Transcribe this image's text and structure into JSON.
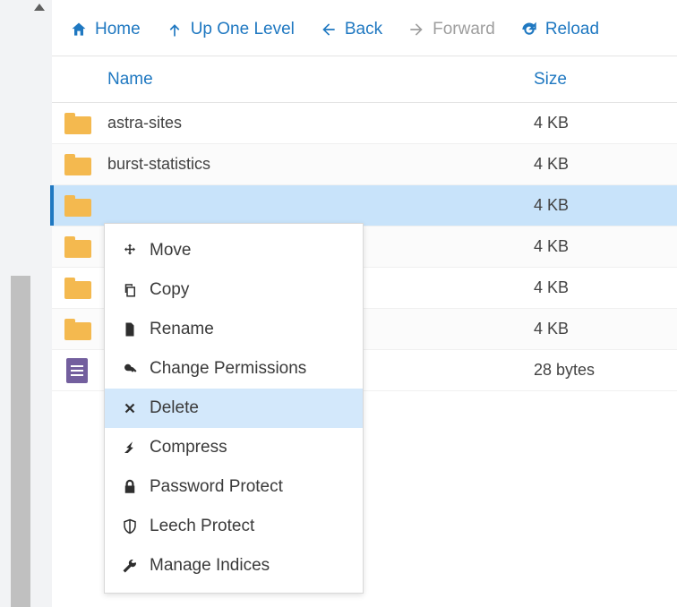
{
  "toolbar": {
    "home": {
      "label": "Home"
    },
    "up": {
      "label": "Up One Level"
    },
    "back": {
      "label": "Back"
    },
    "forward": {
      "label": "Forward"
    },
    "reload": {
      "label": "Reload"
    }
  },
  "columns": {
    "name": "Name",
    "size": "Size"
  },
  "rows": [
    {
      "type": "folder",
      "name": "astra-sites",
      "size": "4 KB",
      "selected": false
    },
    {
      "type": "folder",
      "name": "burst-statistics",
      "size": "4 KB",
      "selected": false
    },
    {
      "type": "folder",
      "name": "",
      "size": "4 KB",
      "selected": true
    },
    {
      "type": "folder",
      "name": "",
      "size": "4 KB",
      "selected": false
    },
    {
      "type": "folder",
      "name": "",
      "size": "4 KB",
      "selected": false
    },
    {
      "type": "folder",
      "name": "",
      "size": "4 KB",
      "selected": false
    },
    {
      "type": "file",
      "name": "",
      "size": "28 bytes",
      "selected": false
    }
  ],
  "contextMenu": {
    "items": [
      {
        "icon": "move",
        "label": "Move",
        "hover": false
      },
      {
        "icon": "copy",
        "label": "Copy",
        "hover": false
      },
      {
        "icon": "rename",
        "label": "Rename",
        "hover": false
      },
      {
        "icon": "key",
        "label": "Change Permissions",
        "hover": false
      },
      {
        "icon": "delete",
        "label": "Delete",
        "hover": true
      },
      {
        "icon": "compress",
        "label": "Compress",
        "hover": false
      },
      {
        "icon": "lock",
        "label": "Password Protect",
        "hover": false
      },
      {
        "icon": "shield",
        "label": "Leech Protect",
        "hover": false
      },
      {
        "icon": "wrench",
        "label": "Manage Indices",
        "hover": false
      }
    ]
  }
}
